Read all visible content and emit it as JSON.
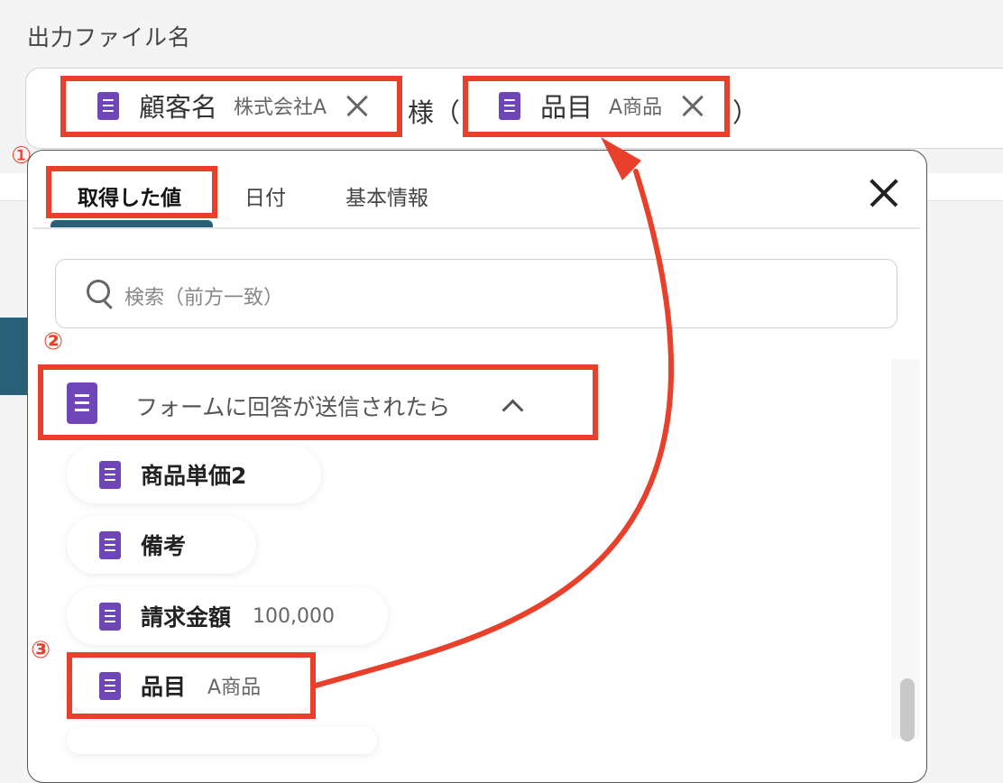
{
  "field_label": "出力ファイル名",
  "tags": [
    {
      "name": "顧客名",
      "value": "株式会社A"
    },
    {
      "name": "品目",
      "value": "A商品"
    }
  ],
  "field_text": {
    "middle": "様（",
    "end": "）"
  },
  "annotations": {
    "one": "①",
    "two": "②",
    "three": "③"
  },
  "tabs": {
    "t1": "取得した値",
    "t2": "日付",
    "t3": "基本情報"
  },
  "search": {
    "placeholder": "検索（前方一致）"
  },
  "group": {
    "label": "フォームに回答が送信されたら"
  },
  "items": [
    {
      "name": "商品単価2",
      "value": ""
    },
    {
      "name": "備考",
      "value": ""
    },
    {
      "name": "請求金額",
      "value": "100,000"
    },
    {
      "name": "品目",
      "value": "A商品"
    }
  ],
  "colors": {
    "accent_red": "#e8402a",
    "teal": "#2a5f78",
    "form_icon": "#6f46b8"
  }
}
